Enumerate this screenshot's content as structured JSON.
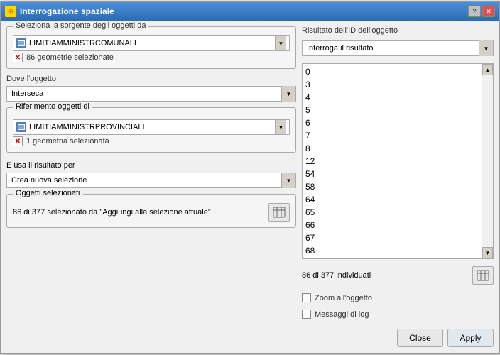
{
  "window": {
    "title": "Interrogazione spaziale",
    "help_btn": "?",
    "close_btn": "✕"
  },
  "left": {
    "source_group_label": "Seleziona la sorgente degli oggetti da",
    "source_layer": "LIMITIAMMINISTRCOMUNALI",
    "source_selected": "86 geometrie selezionate",
    "where_label": "Dove l'oggetto",
    "where_value": "Interseca",
    "ref_group_label": "Riferimento oggetti di",
    "ref_layer": "LIMITIAMMINISTRPROVINCIALI",
    "ref_selected": "1 geometria selezionata",
    "use_label": "E usa il risultato per",
    "use_value": "Crea nuova selezione",
    "objects_group_label": "Oggetti selezionati",
    "objects_text": "86 di 377 selezionato da \"Aggiungi alla selezione attuale\""
  },
  "right": {
    "result_id_label": "Risultato dell'ID dell'oggetto",
    "result_query_value": "Interroga il risultato",
    "list_items": [
      "0",
      "3",
      "4",
      "5",
      "6",
      "7",
      "8",
      "12",
      "54",
      "58",
      "64",
      "65",
      "66",
      "67",
      "68"
    ],
    "found_text": "86 di 377 individuati",
    "zoom_label": "Zoom all'oggetto",
    "log_label": "Messaggi di log"
  },
  "buttons": {
    "close_label": "Close",
    "apply_label": "Apply"
  }
}
